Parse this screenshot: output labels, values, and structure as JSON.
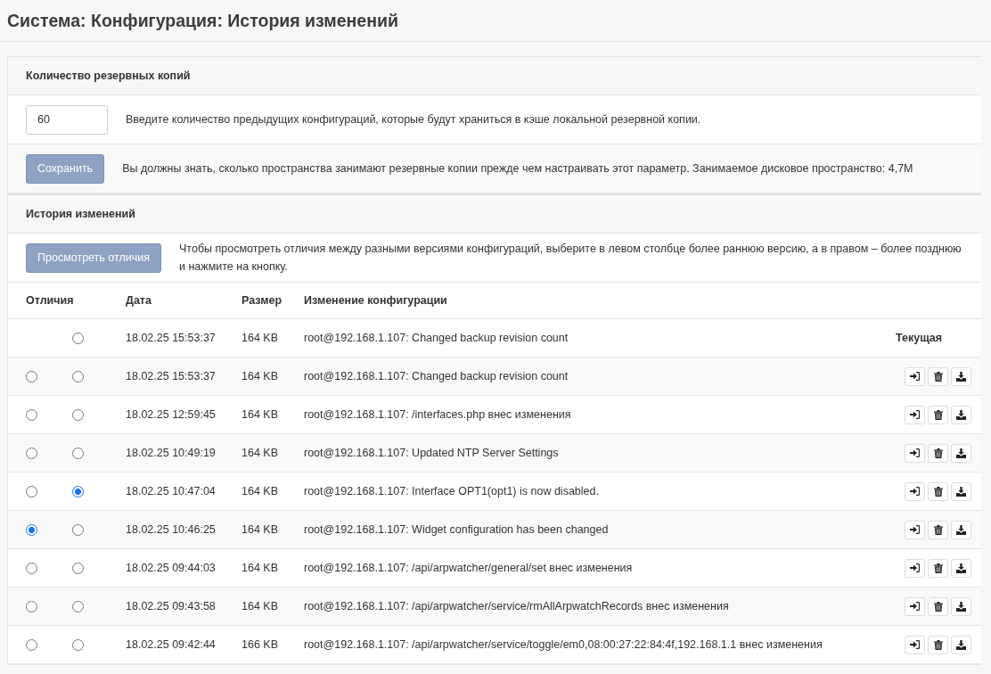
{
  "page_title": "Система: Конфигурация: История изменений",
  "backup_count": {
    "heading": "Количество резервных копий",
    "value": "60",
    "hint": "Введите количество предыдущих конфигураций, которые будут храниться в кэше локальной резервной копии.",
    "save_button": "Сохранить",
    "note": "Вы должны знать, сколько пространства занимают резервные копии прежде чем настраивать этот параметр. Занимаемое дисковое пространство: 4,7M"
  },
  "history": {
    "heading": "История изменений",
    "diff_button": "Просмотреть отличия",
    "hint": "Чтобы просмотреть отличия между разными версиями конфигураций, выберите в левом столбце более раннюю версию, а в правом – более позднюю и нажмите на кнопку.",
    "columns": [
      "Отличия",
      "Дата",
      "Размер",
      "Изменение конфигурации"
    ],
    "rows": [
      {
        "kind": "current",
        "right_selected": false,
        "date": "18.02.25 15:53:37",
        "size": "164 KB",
        "change": "root@192.168.1.107: Changed backup revision count",
        "status": "Текущая"
      },
      {
        "kind": "revision",
        "left_selected": false,
        "right_selected": false,
        "date": "18.02.25 15:53:37",
        "size": "164 KB",
        "change": "root@192.168.1.107: Changed backup revision count"
      },
      {
        "kind": "revision",
        "left_selected": false,
        "right_selected": false,
        "date": "18.02.25 12:59:45",
        "size": "164 KB",
        "change": "root@192.168.1.107: /interfaces.php внес изменения"
      },
      {
        "kind": "revision",
        "left_selected": false,
        "right_selected": false,
        "date": "18.02.25 10:49:19",
        "size": "164 KB",
        "change": "root@192.168.1.107: Updated NTP Server Settings"
      },
      {
        "kind": "revision",
        "left_selected": false,
        "right_selected": true,
        "date": "18.02.25 10:47:04",
        "size": "164 KB",
        "change": "root@192.168.1.107: Interface OPT1(opt1) is now disabled."
      },
      {
        "kind": "revision",
        "left_selected": true,
        "right_selected": false,
        "date": "18.02.25 10:46:25",
        "size": "164 KB",
        "change": "root@192.168.1.107: Widget configuration has been changed"
      },
      {
        "kind": "revision",
        "left_selected": false,
        "right_selected": false,
        "date": "18.02.25 09:44:03",
        "size": "164 KB",
        "change": "root@192.168.1.107: /api/arpwatcher/general/set внес изменения"
      },
      {
        "kind": "revision",
        "left_selected": false,
        "right_selected": false,
        "date": "18.02.25 09:43:58",
        "size": "164 KB",
        "change": "root@192.168.1.107: /api/arpwatcher/service/rmAllArpwatchRecords внес изменения"
      },
      {
        "kind": "revision",
        "left_selected": false,
        "right_selected": false,
        "date": "18.02.25 09:42:44",
        "size": "166 KB",
        "change": "root@192.168.1.107: /api/arpwatcher/service/toggle/em0,08:00:27:22:84:4f,192.168.1.1 внес изменения"
      }
    ]
  }
}
